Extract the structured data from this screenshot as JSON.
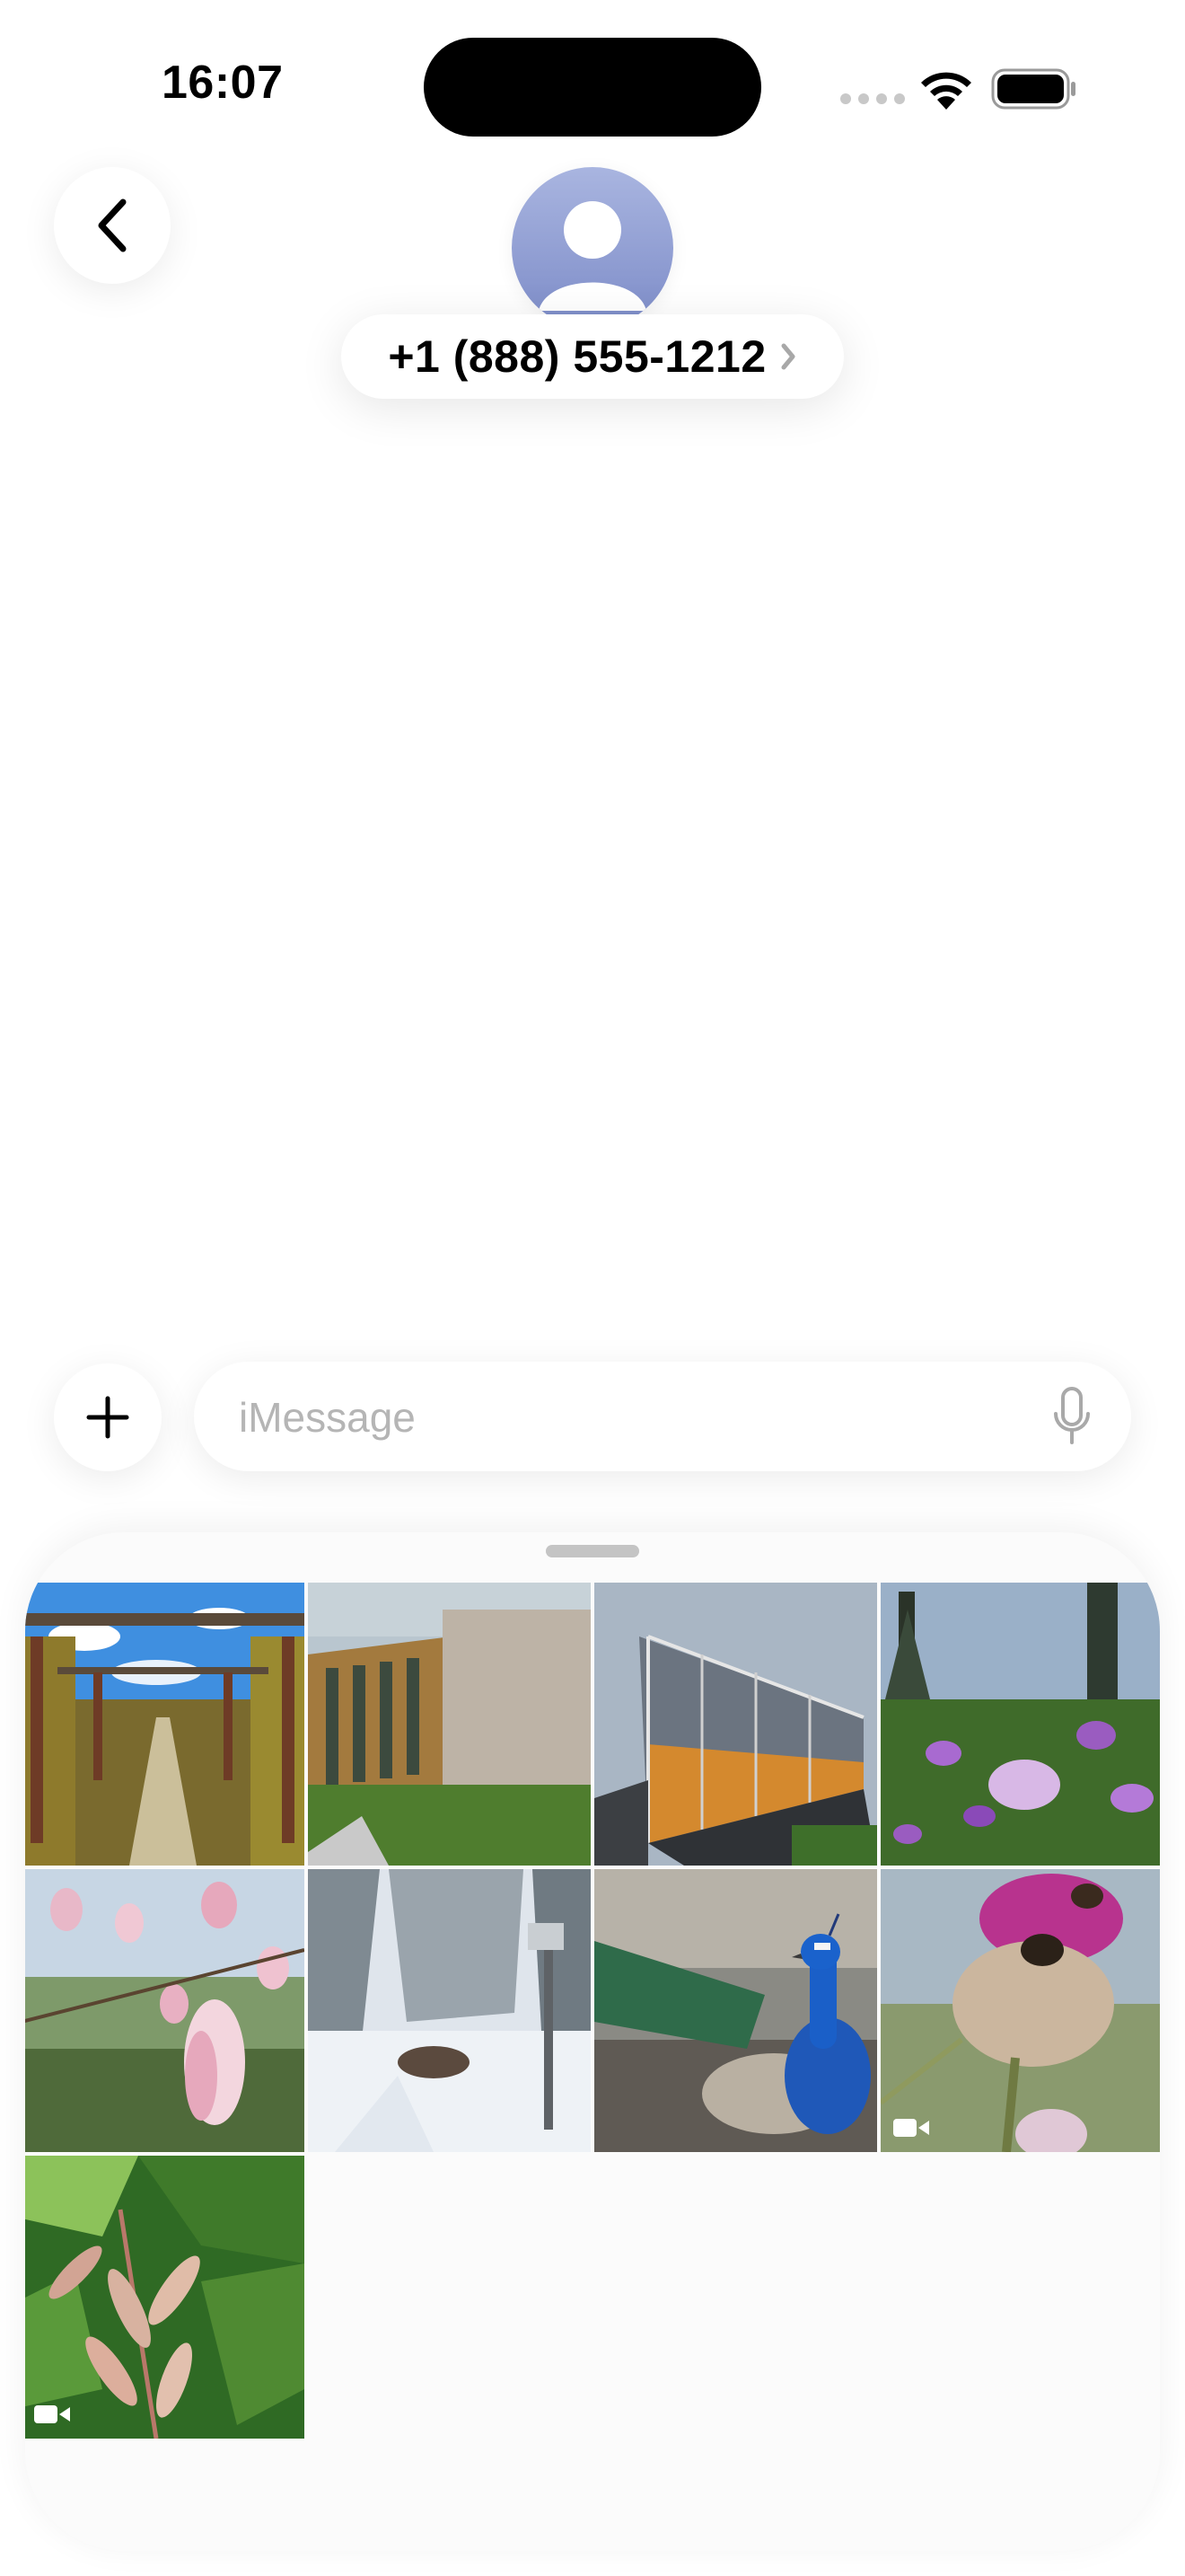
{
  "status_bar": {
    "time": "16:07"
  },
  "header": {
    "back_icon": "chevron-left-icon",
    "avatar_icon": "person-silhouette-icon",
    "contact_name": "+1 (888) 555-1212"
  },
  "composer": {
    "plus_icon": "plus-icon",
    "placeholder": "iMessage",
    "value": "",
    "mic_icon": "microphone-icon"
  },
  "photo_picker": {
    "photos": [
      {
        "subject": "pergola-walkway",
        "video": false
      },
      {
        "subject": "modern-building",
        "video": false
      },
      {
        "subject": "greenhouse",
        "video": false
      },
      {
        "subject": "crocus-meadow",
        "video": false
      },
      {
        "subject": "magnolia-blossoms",
        "video": false
      },
      {
        "subject": "snowy-garden",
        "video": false
      },
      {
        "subject": "peacock",
        "video": false
      },
      {
        "subject": "thistle-with-bee",
        "video": true
      },
      {
        "subject": "maple-seeds",
        "video": true
      }
    ]
  },
  "colors": {
    "avatar_top": "#a9b5e0",
    "avatar_bottom": "#7d8cc8",
    "placeholder_text": "#b5b5b5",
    "sheet_background": "#fbfbfb"
  }
}
